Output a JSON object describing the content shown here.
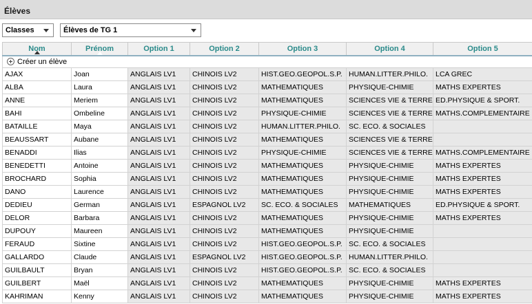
{
  "window": {
    "title": "Élèves"
  },
  "toolbar": {
    "classes_select": "Classes",
    "group_select": "Élèves de TG 1"
  },
  "table": {
    "create_label": "Créer un élève",
    "columns": [
      "Nom",
      "Prénom",
      "Option 1",
      "Option 2",
      "Option 3",
      "Option 4",
      "Option 5"
    ],
    "rows": [
      [
        "AJAX",
        "Joan",
        "ANGLAIS LV1",
        "CHINOIS LV2",
        "HIST.GEO.GEOPOL.S.P.",
        "HUMAN.LITTER.PHILO.",
        "LCA GREC"
      ],
      [
        "ALBA",
        "Laura",
        "ANGLAIS LV1",
        "CHINOIS LV2",
        "MATHEMATIQUES",
        "PHYSIQUE-CHIMIE",
        "MATHS EXPERTES"
      ],
      [
        "ANNE",
        "Meriem",
        "ANGLAIS LV1",
        "CHINOIS LV2",
        "MATHEMATIQUES",
        "SCIENCES VIE & TERRE",
        "ED.PHYSIQUE & SPORT."
      ],
      [
        "BAHI",
        "Ombeline",
        "ANGLAIS LV1",
        "CHINOIS LV2",
        "PHYSIQUE-CHIMIE",
        "SCIENCES VIE & TERRE",
        "MATHS.COMPLEMENTAIRE"
      ],
      [
        "BATAILLE",
        "Maya",
        "ANGLAIS LV1",
        "CHINOIS LV2",
        "HUMAN.LITTER.PHILO.",
        "SC. ECO. & SOCIALES",
        ""
      ],
      [
        "BEAUSSART",
        "Aubane",
        "ANGLAIS LV1",
        "CHINOIS LV2",
        "MATHEMATIQUES",
        "SCIENCES VIE & TERRE",
        ""
      ],
      [
        "BENADDI",
        "Ilias",
        "ANGLAIS LV1",
        "CHINOIS LV2",
        "PHYSIQUE-CHIMIE",
        "SCIENCES VIE & TERRE",
        "MATHS.COMPLEMENTAIRE"
      ],
      [
        "BENEDETTI",
        "Antoine",
        "ANGLAIS LV1",
        "CHINOIS LV2",
        "MATHEMATIQUES",
        "PHYSIQUE-CHIMIE",
        "MATHS EXPERTES"
      ],
      [
        "BROCHARD",
        "Sophia",
        "ANGLAIS LV1",
        "CHINOIS LV2",
        "MATHEMATIQUES",
        "PHYSIQUE-CHIMIE",
        "MATHS EXPERTES"
      ],
      [
        "DANO",
        "Laurence",
        "ANGLAIS LV1",
        "CHINOIS LV2",
        "MATHEMATIQUES",
        "PHYSIQUE-CHIMIE",
        "MATHS EXPERTES"
      ],
      [
        "DEDIEU",
        "German",
        "ANGLAIS LV1",
        "ESPAGNOL LV2",
        "SC. ECO. & SOCIALES",
        "MATHEMATIQUES",
        "ED.PHYSIQUE & SPORT."
      ],
      [
        "DELOR",
        "Barbara",
        "ANGLAIS LV1",
        "CHINOIS LV2",
        "MATHEMATIQUES",
        "PHYSIQUE-CHIMIE",
        "MATHS EXPERTES"
      ],
      [
        "DUPOUY",
        "Maureen",
        "ANGLAIS LV1",
        "CHINOIS LV2",
        "MATHEMATIQUES",
        "PHYSIQUE-CHIMIE",
        ""
      ],
      [
        "FERAUD",
        "Sixtine",
        "ANGLAIS LV1",
        "CHINOIS LV2",
        "HIST.GEO.GEOPOL.S.P.",
        "SC. ECO. & SOCIALES",
        ""
      ],
      [
        "GALLARDO",
        "Claude",
        "ANGLAIS LV1",
        "ESPAGNOL LV2",
        "HIST.GEO.GEOPOL.S.P.",
        "HUMAN.LITTER.PHILO.",
        ""
      ],
      [
        "GUILBAULT",
        "Bryan",
        "ANGLAIS LV1",
        "CHINOIS LV2",
        "HIST.GEO.GEOPOL.S.P.",
        "SC. ECO. & SOCIALES",
        ""
      ],
      [
        "GUILBERT",
        "Maël",
        "ANGLAIS LV1",
        "CHINOIS LV2",
        "MATHEMATIQUES",
        "PHYSIQUE-CHIMIE",
        "MATHS EXPERTES"
      ],
      [
        "KAHRIMAN",
        "Kenny",
        "ANGLAIS LV1",
        "CHINOIS LV2",
        "MATHEMATIQUES",
        "PHYSIQUE-CHIMIE",
        "MATHS EXPERTES"
      ]
    ]
  }
}
